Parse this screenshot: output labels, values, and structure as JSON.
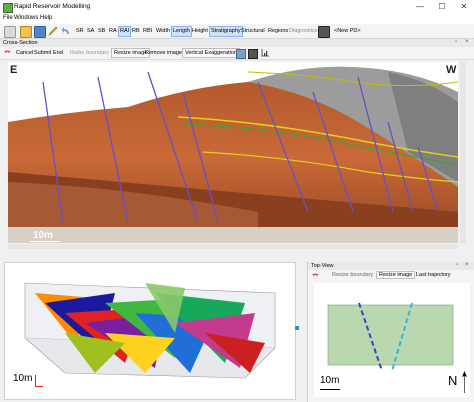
{
  "window": {
    "title": "Rapid Reservoir Modelling",
    "controls": [
      "—",
      "☐",
      "✕"
    ]
  },
  "menu": [
    "File",
    "Windows",
    "Help"
  ],
  "toolbar": {
    "buttons": [
      "SR",
      "SA",
      "SB",
      "RA",
      "RAI",
      "RB",
      "RBI",
      "Width",
      "Length",
      "Height",
      "Stratigraphy",
      "Structural",
      "Regions",
      "Diagnostics",
      "<New PD>"
    ],
    "active": [
      "RAI",
      "Length",
      "Stratigraphy"
    ],
    "disabled": [
      "Diagnostics"
    ]
  },
  "cross_section": {
    "header": "Cross-Section",
    "buttons": [
      "Cancel",
      "Submit",
      "End",
      "Reibe boundary",
      "Resize image",
      "Remove image",
      "Vertical Exaggeration"
    ],
    "left_label": "E",
    "right_label": "W",
    "scale_label": "10m"
  },
  "view3d": {
    "scale_label": "10m"
  },
  "top_view": {
    "header": "Top-View",
    "buttons": [
      "Resize boundary",
      "Resize image",
      "Last trajectory"
    ],
    "scale_label": "10m",
    "north_label": "N"
  },
  "colors": {
    "accent": "#cfe1f5",
    "fault": "#6a4fc8",
    "horizon_yellow": "#e0d21c",
    "horizon_green": "#3fa52f",
    "topview_fill": "#b9d8b0"
  }
}
